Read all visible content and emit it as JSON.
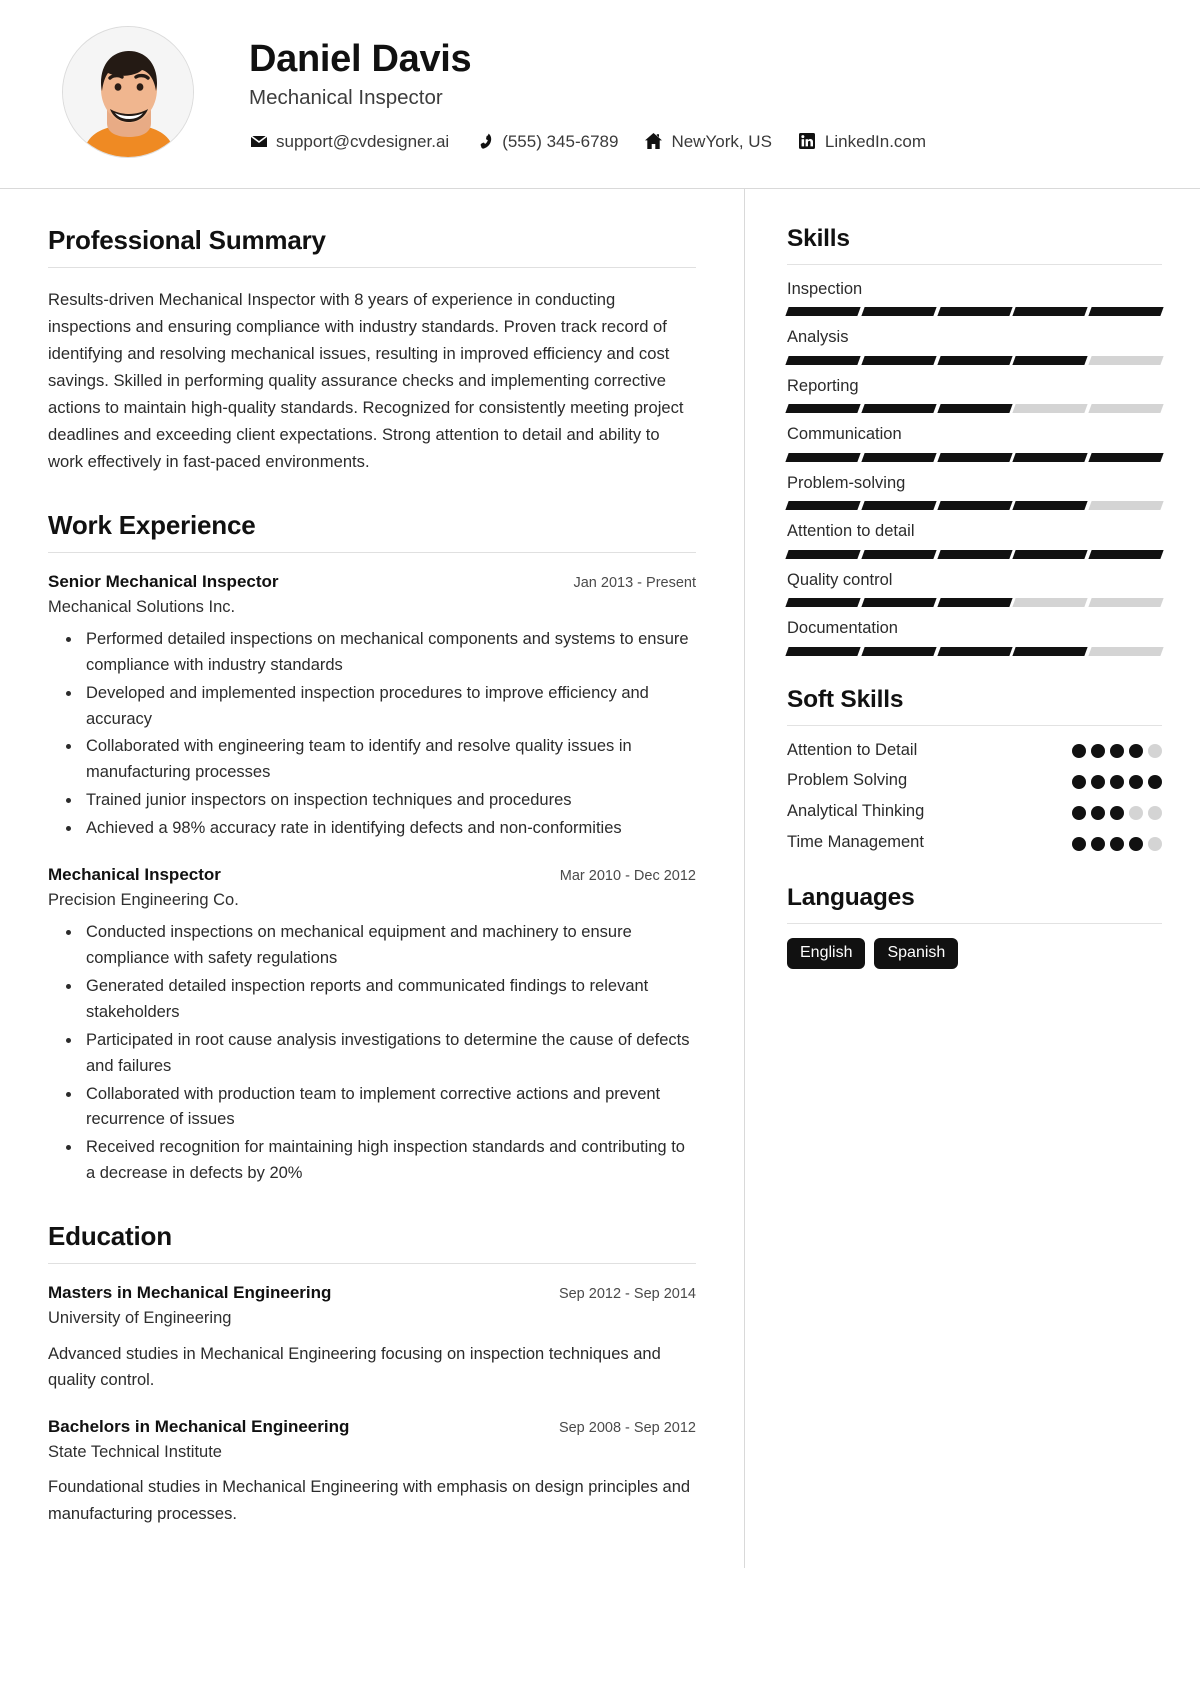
{
  "header": {
    "name": "Daniel Davis",
    "role": "Mechanical Inspector",
    "avatar_alt": "profile-photo",
    "contacts": [
      {
        "icon": "email-icon",
        "value": "support@cvdesigner.ai"
      },
      {
        "icon": "phone-icon",
        "value": "(555) 345-6789"
      },
      {
        "icon": "home-icon",
        "value": "NewYork, US"
      },
      {
        "icon": "linkedin-icon",
        "value": "LinkedIn.com"
      }
    ]
  },
  "summary": {
    "title": "Professional Summary",
    "text": "Results-driven Mechanical Inspector with 8 years of experience in conducting inspections and ensuring compliance with industry standards. Proven track record of identifying and resolving mechanical issues, resulting in improved efficiency and cost savings. Skilled in performing quality assurance checks and implementing corrective actions to maintain high-quality standards. Recognized for consistently meeting project deadlines and exceeding client expectations. Strong attention to detail and ability to work effectively in fast-paced environments."
  },
  "work": {
    "title": "Work Experience",
    "entries": [
      {
        "position": "Senior Mechanical Inspector",
        "company": "Mechanical Solutions Inc.",
        "date": "Jan 2013 - Present",
        "bullets": [
          "Performed detailed inspections on mechanical components and systems to ensure compliance with industry standards",
          "Developed and implemented inspection procedures to improve efficiency and accuracy",
          "Collaborated with engineering team to identify and resolve quality issues in manufacturing processes",
          "Trained junior inspectors on inspection techniques and procedures",
          "Achieved a 98% accuracy rate in identifying defects and non-conformities"
        ]
      },
      {
        "position": "Mechanical Inspector",
        "company": "Precision Engineering Co.",
        "date": "Mar 2010 - Dec 2012",
        "bullets": [
          "Conducted inspections on mechanical equipment and machinery to ensure compliance with safety regulations",
          "Generated detailed inspection reports and communicated findings to relevant stakeholders",
          "Participated in root cause analysis investigations to determine the cause of defects and failures",
          "Collaborated with production team to implement corrective actions and prevent recurrence of issues",
          "Received recognition for maintaining high inspection standards and contributing to a decrease in defects by 20%"
        ]
      }
    ]
  },
  "education": {
    "title": "Education",
    "entries": [
      {
        "degree": "Masters in Mechanical Engineering",
        "school": "University of Engineering",
        "date": "Sep 2012 - Sep 2014",
        "description": "Advanced studies in Mechanical Engineering focusing on inspection techniques and quality control."
      },
      {
        "degree": "Bachelors in Mechanical Engineering",
        "school": "State Technical Institute",
        "date": "Sep 2008 - Sep 2012",
        "description": "Foundational studies in Mechanical Engineering with emphasis on design principles and manufacturing processes."
      }
    ]
  },
  "skills": {
    "title": "Skills",
    "max": 5,
    "items": [
      {
        "name": "Inspection",
        "level": 5
      },
      {
        "name": "Analysis",
        "level": 4
      },
      {
        "name": "Reporting",
        "level": 3
      },
      {
        "name": "Communication",
        "level": 5
      },
      {
        "name": "Problem-solving",
        "level": 4
      },
      {
        "name": "Attention to detail",
        "level": 5
      },
      {
        "name": "Quality control",
        "level": 3
      },
      {
        "name": "Documentation",
        "level": 4
      }
    ]
  },
  "soft_skills": {
    "title": "Soft Skills",
    "max": 5,
    "items": [
      {
        "name": "Attention to Detail",
        "level": 4
      },
      {
        "name": "Problem Solving",
        "level": 5
      },
      {
        "name": "Analytical Thinking",
        "level": 3
      },
      {
        "name": "Time Management",
        "level": 4
      }
    ]
  },
  "languages": {
    "title": "Languages",
    "items": [
      "English",
      "Spanish"
    ]
  },
  "colors": {
    "accent": "#111111",
    "muted_bar": "#d4d4d4",
    "rule": "#e0e0e0",
    "shirt": "#ef8a23"
  }
}
